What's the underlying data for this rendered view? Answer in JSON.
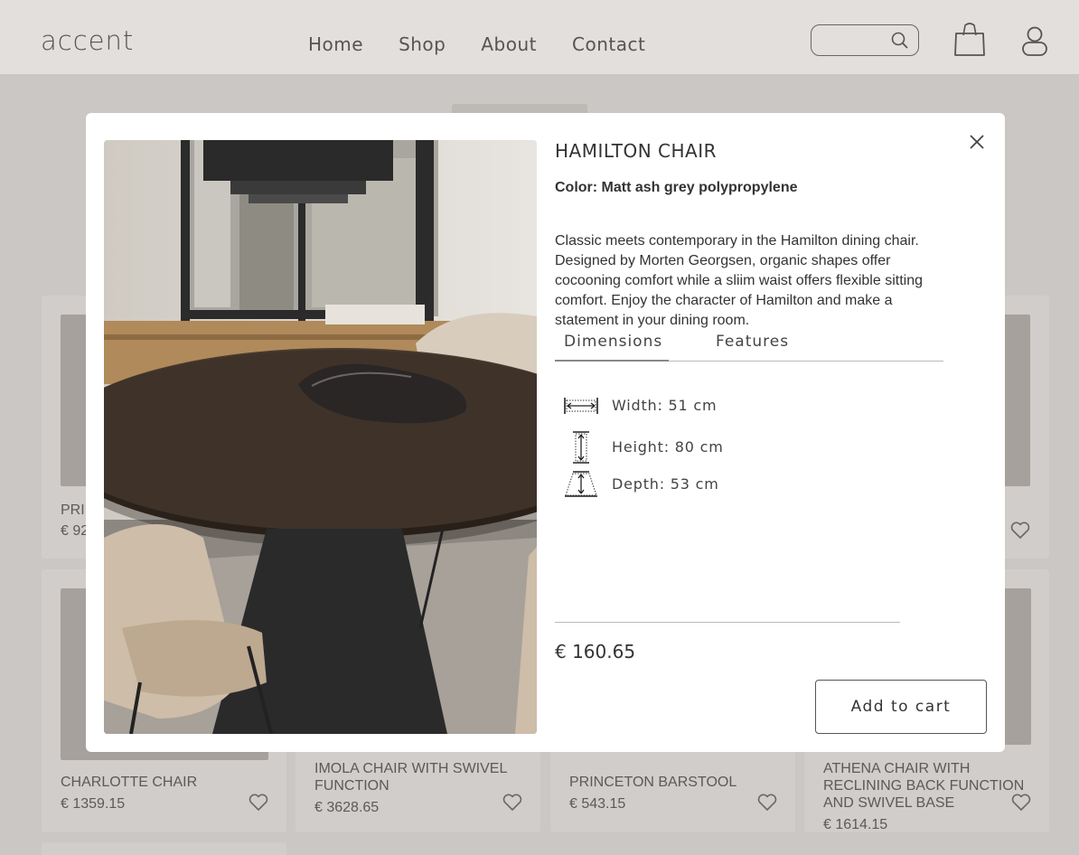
{
  "header": {
    "logo": "accent",
    "nav": [
      "Home",
      "Shop",
      "About",
      "Contact"
    ],
    "search_placeholder": ""
  },
  "background_products": [
    {
      "name": "PRI",
      "price": "€ 92"
    },
    {
      "name": "CHARLOTTE CHAIR",
      "price": "€ 1359.15"
    },
    {
      "name": "IMOLA CHAIR WITH SWIVEL FUNCTION",
      "price": "€ 3628.65"
    },
    {
      "name": "PRINCETON BARSTOOL",
      "price": "€ 543.15"
    },
    {
      "name": "ATHENA CHAIR WITH RECLINING BACK FUNCTION AND SWIVEL BASE",
      "price": "€ 1614.15"
    }
  ],
  "modal": {
    "title": "HAMILTON CHAIR",
    "color": "Color: Matt ash grey polypropylene",
    "description": "Classic meets contemporary in the Hamilton dining chair. Designed by Morten Georgsen, organic shapes offer cocooning comfort while a sliim waist offers flexible sitting comfort. Enjoy the character of Hamilton and make a statement in your dining room.",
    "tabs": [
      {
        "label": "Dimensions",
        "active": true
      },
      {
        "label": "Features",
        "active": false
      }
    ],
    "dimensions": [
      {
        "icon": "width-icon",
        "label": "Width: 51 cm"
      },
      {
        "icon": "height-icon",
        "label": "Height: 80 cm"
      },
      {
        "icon": "depth-icon",
        "label": "Depth: 53 cm"
      }
    ],
    "price": "€ 160.65",
    "add_to_cart": "Add to cart"
  }
}
